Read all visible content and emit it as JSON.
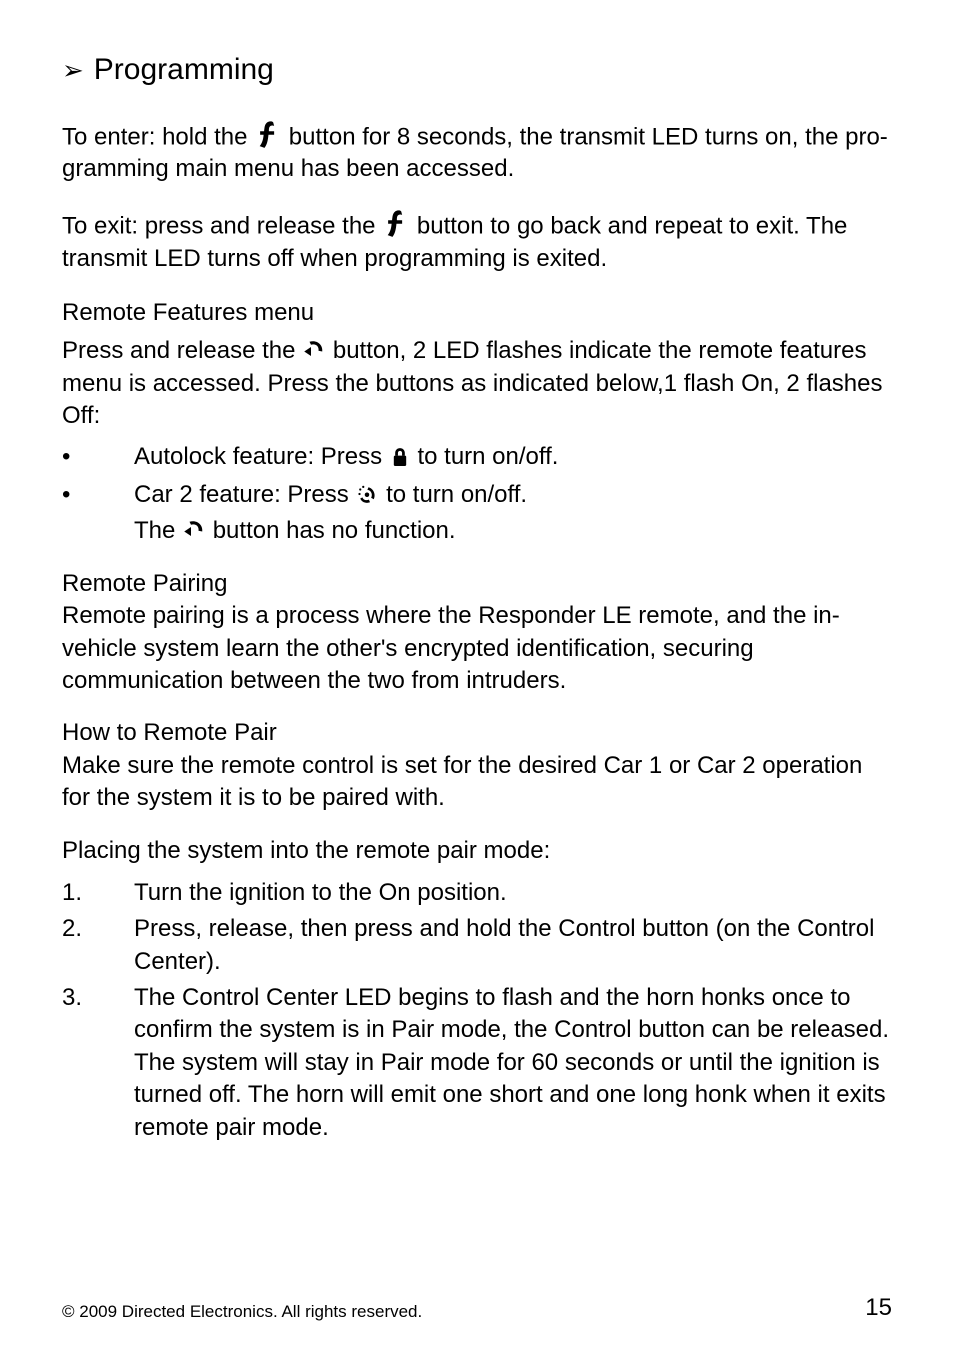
{
  "header": {
    "title": "Programming"
  },
  "para1": {
    "lead": "To enter: ",
    "hold": "hold",
    "mid": " the ",
    "tail": " button for 8 seconds, the transmit LED turns on, the pro­gramming main menu has been accessed."
  },
  "para2": {
    "lead": "To exit: ",
    "press": "press",
    "and": " and ",
    "release": "release",
    "mid": " the ",
    "tail": " button to go back and repeat to exit. The transmit LED turns off when programming is exited."
  },
  "remoteFeatures": {
    "heading": "Remote Features menu",
    "p": {
      "press": "Press",
      "and": " and ",
      "release": "release",
      "mid": " the ",
      "tail1": " button, 2 LED flashes indicate the remote features menu is accessed. ",
      "press2": "Press",
      "tail2": " the buttons as indicated below,1 flash On,  2 flashes Off:"
    },
    "bullets": {
      "b1a": "Autolock feature: Press ",
      "b1b": " to turn on/off.",
      "b2a": "Car 2 feature: Press ",
      "b2b": " to turn on/off.",
      "b2c_a": "The ",
      "b2c_b": " button has no function."
    }
  },
  "remotePairing": {
    "heading": "Remote Pairing",
    "body": "Remote pairing is a process where the Responder LE remote, and the in-vehicle system learn the other's encrypted identification, securing communication between the two from intruders."
  },
  "howTo": {
    "heading": "How to Remote Pair",
    "body": "Make sure the remote control is set for the desired Car 1 or Car 2 operation for the system it is to be paired with."
  },
  "placing": {
    "heading": "Placing the system into the remote pair mode:",
    "steps": [
      "Turn the ignition to the On position.",
      "Press, release, then press and hold the Control button (on the Control Center).",
      "The Control Center LED begins to flash and the horn honks once to confirm the system is in Pair mode, the Control button can be released. The system will stay in Pair mode for 60 seconds or until the ignition is turned off. The horn will emit one short and one long honk when it exits remote pair mode."
    ]
  },
  "footer": {
    "copyright": "© 2009 Directed Electronics. All rights reserved.",
    "page": "15"
  }
}
